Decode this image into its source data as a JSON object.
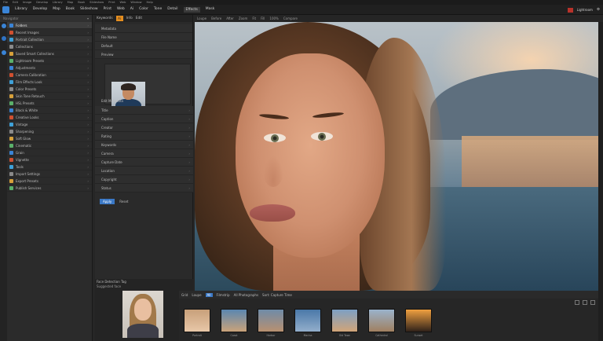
{
  "menubar": [
    "File",
    "Edit",
    "Image",
    "Develop",
    "Library",
    "Map",
    "Book",
    "Slideshow",
    "Print",
    "Web",
    "Window",
    "Help"
  ],
  "appbar": {
    "items": [
      "Library",
      "Develop",
      "Map",
      "Book",
      "Slideshow",
      "Print",
      "Web",
      "Ai",
      "Color",
      "Tone",
      "Detail",
      "Effects",
      "Mask"
    ],
    "active_index": 11,
    "right_label": "Lightroom"
  },
  "left_panel": {
    "header": "Navigator",
    "rows": [
      {
        "label": "Folders",
        "sel": true
      },
      {
        "label": "Recent Images",
        "strong": false
      },
      {
        "label": "Portrait Collection",
        "strong": true
      },
      {
        "label": "Collections"
      },
      {
        "label": "Saved Smart Collections"
      },
      {
        "label": "Lightroom Presets"
      },
      {
        "label": "Adjustments"
      },
      {
        "label": "Camera Calibration"
      },
      {
        "label": "Film Effects Look"
      },
      {
        "label": "Color Presets"
      },
      {
        "label": "Skin Tone Retouch"
      },
      {
        "label": "HSL Presets"
      },
      {
        "label": "Black & White"
      },
      {
        "label": "Creative Looks"
      },
      {
        "label": "Vintage"
      },
      {
        "label": "Sharpening"
      },
      {
        "label": "Soft Glow"
      },
      {
        "label": "Cinematic"
      },
      {
        "label": "Grain"
      },
      {
        "label": "Vignette"
      },
      {
        "label": "Tools"
      },
      {
        "label": "Import Settings"
      },
      {
        "label": "Export Presets"
      },
      {
        "label": "Publish Services"
      }
    ]
  },
  "mid_panel": {
    "tabs": [
      "Keywords",
      "Ai",
      "Info",
      "Edit"
    ],
    "rows": [
      "Metadata",
      "File Name",
      "Default",
      "Preview"
    ],
    "caption": "Edit Metadata",
    "rows2": [
      "Title",
      "Caption",
      "Creator",
      "Rating",
      "Keywords",
      "Camera",
      "Capture Date",
      "Location",
      "Copyright",
      "Status"
    ],
    "button": "Apply",
    "button2_label": "Reset"
  },
  "topstrip": [
    "Loupe",
    "Before",
    "After",
    "Zoom",
    "Fit",
    "Fill",
    "100%",
    "Compare"
  ],
  "bottom_left": {
    "title": "Face Detection Tag",
    "subtitle": "Suggested face"
  },
  "filmbar": {
    "items": [
      "Grid",
      "Loupe",
      "Filmstrip"
    ],
    "blue": "All",
    "label": "All Photographs",
    "sort": "Sort: Capture Time"
  },
  "film": {
    "thumbs": [
      {
        "label": "Portrait",
        "colors": [
          "#c8a07a",
          "#e8c7a8"
        ]
      },
      {
        "label": "Coast",
        "colors": [
          "#5a86b0",
          "#caa27a"
        ]
      },
      {
        "label": "Harbor",
        "colors": [
          "#6f8ba8",
          "#b89070"
        ]
      },
      {
        "label": "Marina",
        "colors": [
          "#4a78a8",
          "#93aecb"
        ]
      },
      {
        "label": "Old Town",
        "colors": [
          "#7da0c4",
          "#d1a478"
        ]
      },
      {
        "label": "Cathedral",
        "colors": [
          "#9ab3cc",
          "#a08060"
        ]
      },
      {
        "label": "Sunset",
        "colors": [
          "#f0a040",
          "#30221a"
        ]
      }
    ]
  }
}
